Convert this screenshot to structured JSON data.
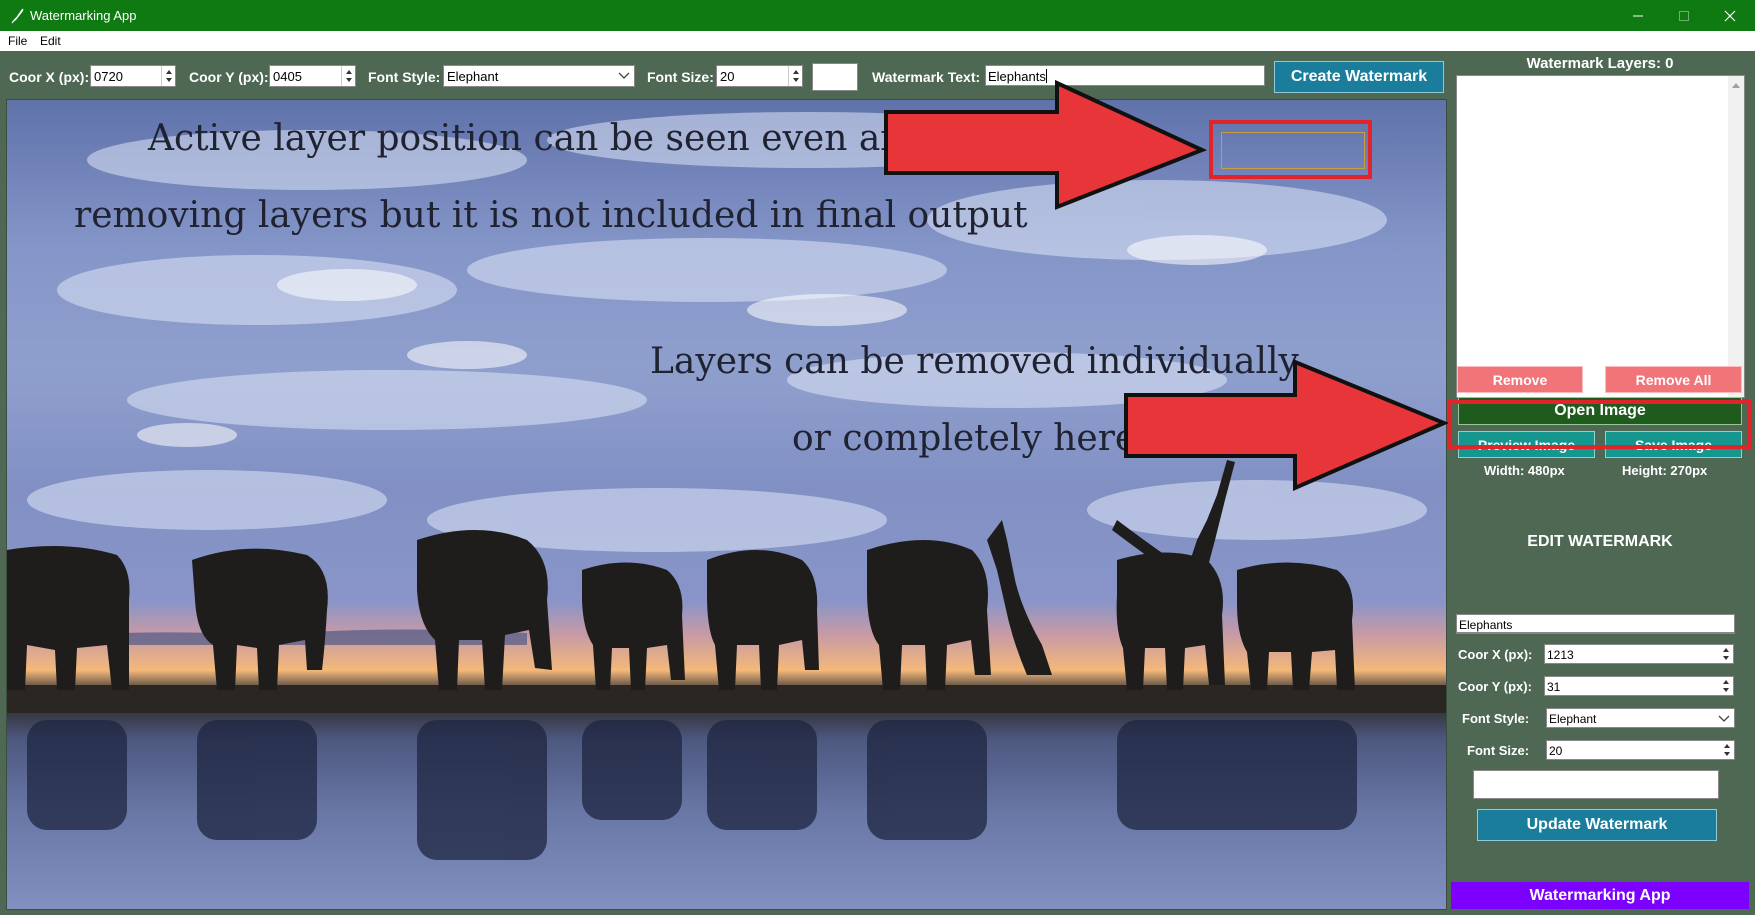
{
  "window": {
    "title": "Watermarking App"
  },
  "menu": {
    "items": [
      "File",
      "Edit"
    ]
  },
  "toolbar": {
    "coor_x_label": "Coor X (px):",
    "coor_x_value": "0720",
    "coor_y_label": "Coor Y (px):",
    "coor_y_value": "0405",
    "font_style_label": "Font Style:",
    "font_style_value": "Elephant",
    "font_size_label": "Font Size:",
    "font_size_value": "20",
    "watermark_text_label": "Watermark Text:",
    "watermark_text_value": "Elephants",
    "create_button": "Create Watermark"
  },
  "annotations": {
    "top_line1": "Active layer position can be seen even after",
    "top_line2": "removing layers but it is not included in final output",
    "mid_line1": "Layers can be removed individually",
    "mid_line2": "or completely here",
    "color": "#e8353a"
  },
  "panel": {
    "layers_title": "Watermark Layers: 0",
    "remove_button": "Remove",
    "remove_all_button": "Remove All",
    "open_button": "Open Image",
    "preview_button": "Preview Image",
    "save_button": "Save Image",
    "width_text": "Width: 480px",
    "height_text": "Height: 270px",
    "edit_title": "EDIT WATERMARK",
    "edit_text_value": "Elephants",
    "edit_x_label": "Coor X (px):",
    "edit_x_value": "1213",
    "edit_y_label": "Coor Y (px):",
    "edit_y_value": "31",
    "edit_font_style_label": "Font Style:",
    "edit_font_style_value": "Elephant",
    "edit_font_size_label": "Font Size:",
    "edit_font_size_value": "20",
    "update_button": "Update Watermark"
  },
  "footer": {
    "label": "Watermarking App"
  },
  "colors": {
    "window_green": "#0f7a12",
    "panel_bg": "#4e6854",
    "accent_blue": "#1a7d9c",
    "remove_red": "#f07478",
    "teal": "#15968e",
    "footer_purple": "#7b00ff",
    "open_green": "#1e5b1c"
  }
}
